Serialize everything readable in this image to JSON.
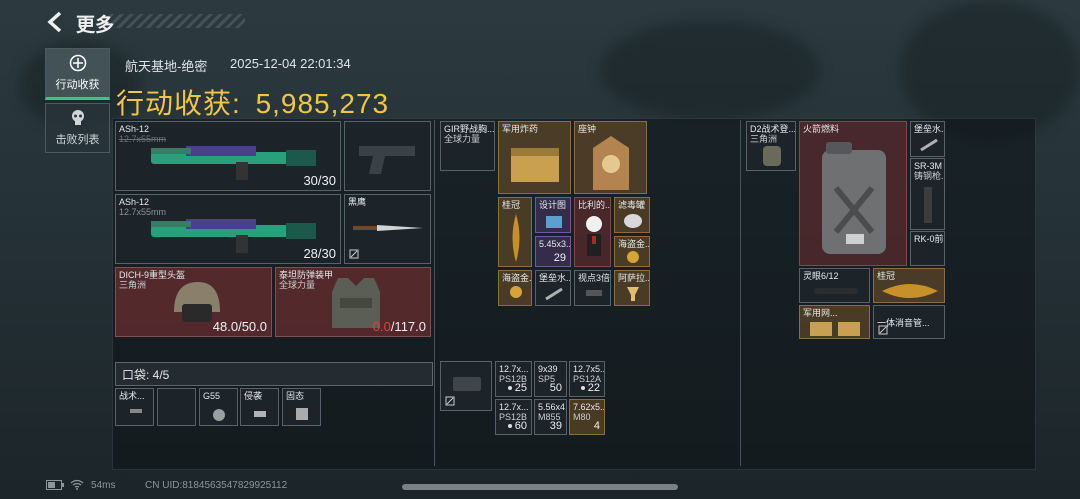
{
  "header": {
    "title": "更多"
  },
  "side_tabs": [
    {
      "label": "行动收获"
    },
    {
      "label": "击败列表"
    }
  ],
  "raid": {
    "map": "航天基地-绝密",
    "datetime": "2025-12-04 22:01:34",
    "loot_label": "行动收获:",
    "loot_value": "5,985,273"
  },
  "loadout": {
    "primary1": {
      "name": "ASh-12",
      "caliber": "12.7x55mm",
      "ammo": "30/30"
    },
    "primary2": {
      "name": "ASh-12",
      "caliber": "12.7x55mm",
      "ammo": "28/30"
    },
    "melee": {
      "name": "黑鹰"
    },
    "helmet": {
      "name": "DICH-9重型头盔",
      "faction": "三角洲",
      "durability": "48.0/50.0"
    },
    "armor": {
      "name": "泰坦防弹装甲",
      "faction": "全球力量",
      "durability_current": "0.0",
      "durability_max": "/117.0"
    }
  },
  "pocket": {
    "label": "口袋: 4/5",
    "slots": [
      "战术...",
      "",
      "G55",
      "侵袭",
      "固态"
    ]
  },
  "chest_rig": {
    "name": "GIR野战胸...",
    "faction": "全球力量",
    "items": [
      {
        "name": "军用炸药"
      },
      {
        "name": "座钟"
      },
      {
        "name": "桂冠"
      },
      {
        "name": "设计图"
      },
      {
        "name": "比利的..."
      },
      {
        "name": "滤毒罐"
      },
      {
        "name": "5.45x3...",
        "count": "29"
      },
      {
        "name": "海盗金..."
      },
      {
        "name": "海盗金..."
      },
      {
        "name": "堡垒水..."
      },
      {
        "name": "视点3倍"
      },
      {
        "name": "阿萨拉..."
      }
    ]
  },
  "ammo": [
    {
      "name": "12.7x...",
      "sub": "PS12B",
      "count": "25"
    },
    {
      "name": "9x39",
      "sub": "SP5",
      "count": "50"
    },
    {
      "name": "12.7x5...",
      "sub": "PS12A",
      "count": "22"
    },
    {
      "name": "12.7x...",
      "sub": "PS12B",
      "count": "60"
    },
    {
      "name": "5.56x4...",
      "sub": "M855",
      "count": "39"
    },
    {
      "name": "7.62x5...",
      "sub": "M80",
      "count": "4"
    }
  ],
  "backpack": {
    "name": "D2战术登...",
    "faction": "三角洲",
    "items": [
      {
        "name": "火箭燃料"
      },
      {
        "name": "堡垒水..."
      },
      {
        "name": "SR-3M",
        "sub": "铸钢枪..."
      },
      {
        "name": "RK-0前..."
      },
      {
        "name": "灵眼6/12"
      },
      {
        "name": "桂冠"
      },
      {
        "name": "军用网..."
      },
      {
        "name": "一体消音管..."
      }
    ]
  },
  "status_bar": {
    "ping": "54ms",
    "uid": "CN UID:8184563547829925112"
  },
  "colors": {
    "loot_gold": "#f3c545",
    "accent_green": "#39c88a",
    "durability_red": "#e04040"
  }
}
